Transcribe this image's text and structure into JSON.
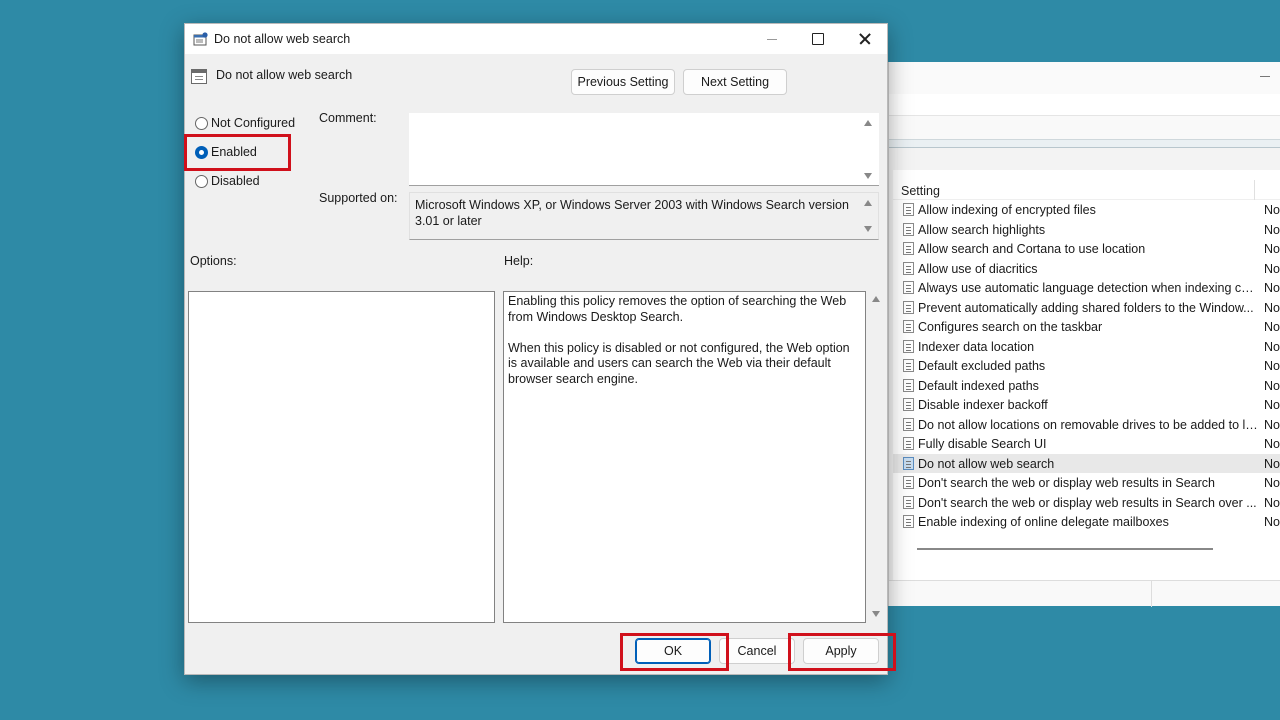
{
  "background_window": {
    "list_header": "Setting",
    "rows": [
      {
        "name": "Allow indexing of encrypted files",
        "state": "No",
        "selected": false
      },
      {
        "name": "Allow search highlights",
        "state": "No",
        "selected": false
      },
      {
        "name": "Allow search and Cortana to use location",
        "state": "No",
        "selected": false
      },
      {
        "name": "Allow use of diacritics",
        "state": "No",
        "selected": false
      },
      {
        "name": "Always use automatic language detection when indexing co...",
        "state": "No",
        "selected": false
      },
      {
        "name": "Prevent automatically adding shared folders to the Window...",
        "state": "No",
        "selected": false
      },
      {
        "name": "Configures search on the taskbar",
        "state": "No",
        "selected": false
      },
      {
        "name": "Indexer data location",
        "state": "No",
        "selected": false
      },
      {
        "name": "Default excluded paths",
        "state": "No",
        "selected": false
      },
      {
        "name": "Default indexed paths",
        "state": "No",
        "selected": false
      },
      {
        "name": "Disable indexer backoff",
        "state": "No",
        "selected": false
      },
      {
        "name": "Do not allow locations on removable drives to be added to li...",
        "state": "No",
        "selected": false
      },
      {
        "name": "Fully disable Search UI",
        "state": "No",
        "selected": false
      },
      {
        "name": "Do not allow web search",
        "state": "No",
        "selected": true
      },
      {
        "name": "Don't search the web or display web results in Search",
        "state": "No",
        "selected": false
      },
      {
        "name": "Don't search the web or display web results in Search over ...",
        "state": "No",
        "selected": false
      },
      {
        "name": "Enable indexing of online delegate mailboxes",
        "state": "No",
        "selected": false
      }
    ]
  },
  "dialog": {
    "title": "Do not allow web search",
    "policy_name": "Do not allow web search",
    "prev_button": "Previous Setting",
    "next_button": "Next Setting",
    "radio_options": {
      "not_configured": "Not Configured",
      "enabled": "Enabled",
      "disabled": "Disabled",
      "selected": "enabled"
    },
    "comment_label": "Comment:",
    "comment_value": "",
    "supported_label": "Supported on:",
    "supported_value": "Microsoft Windows XP, or Windows Server 2003 with Windows Search version 3.01 or later",
    "options_label": "Options:",
    "help_label": "Help:",
    "help_paragraphs": [
      "Enabling this policy removes the option of searching the Web from Windows Desktop Search.",
      "When this policy is disabled or not configured, the Web option is available and users can search the Web via their default browser search engine."
    ],
    "ok_button": "OK",
    "cancel_button": "Cancel",
    "apply_button": "Apply"
  },
  "colors": {
    "desktop": "#2e8aa6",
    "highlight_box": "#d0101b",
    "accent": "#005fb8"
  }
}
